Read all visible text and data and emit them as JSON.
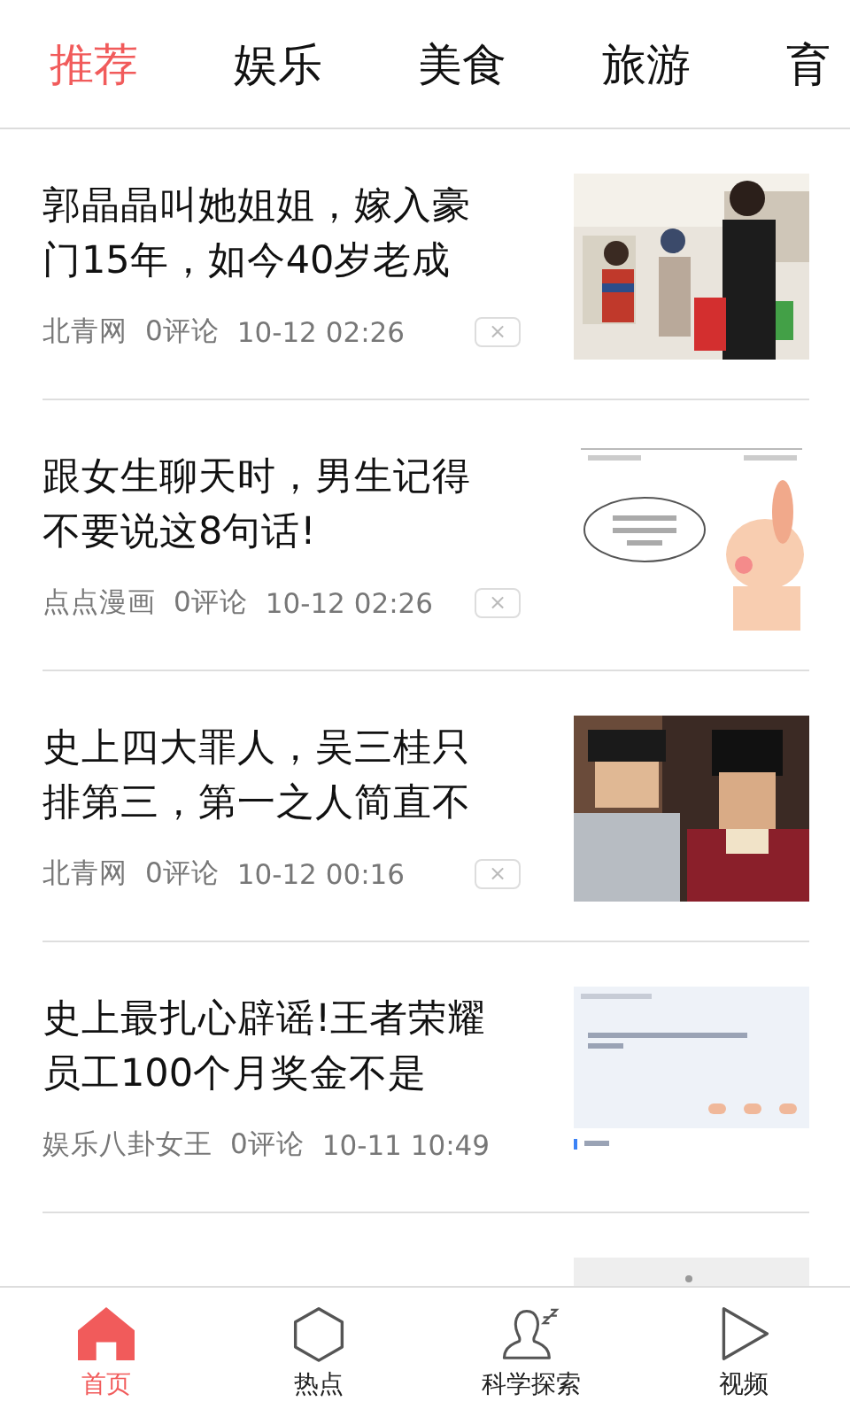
{
  "tabs": [
    {
      "label": "推荐",
      "selected": true
    },
    {
      "label": "娱乐",
      "selected": false
    },
    {
      "label": "美食",
      "selected": false
    },
    {
      "label": "旅游",
      "selected": false
    },
    {
      "label": "育",
      "selected": false
    }
  ],
  "articles": [
    {
      "title": "郭晶晶叫她姐姐，嫁入豪门15年，如今40岁老成",
      "source": "北青网",
      "comments": "0评论",
      "time": "10-12 02:26",
      "dismiss": "×",
      "picture": {
        "kind": "picture"
      }
    },
    {
      "title": "跟女生聊天时，男生记得不要说这8句话!",
      "source": "点点漫画",
      "comments": "0评论",
      "time": "10-12 02:26",
      "dismiss": "×",
      "picture": {
        "kind": "picture"
      }
    },
    {
      "title": "史上四大罪人，吴三桂只排第三，第一之人简直不",
      "source": "北青网",
      "comments": "0评论",
      "time": "10-12 00:16",
      "dismiss": "×",
      "picture": {
        "kind": "picture"
      }
    },
    {
      "title": "史上最扎心辟谣!王者荣耀员工100个月奖金不是",
      "source": "娱乐八卦女王",
      "comments": "0评论",
      "time": "10-11 10:49",
      "picture": {
        "kind": "picture"
      }
    },
    {
      "picture": {
        "kind": "picture"
      }
    }
  ],
  "bottom_nav": [
    {
      "label": "首页",
      "selected": true
    },
    {
      "label": "热点",
      "selected": false
    },
    {
      "label": "科学探索",
      "selected": false
    },
    {
      "label": "视频",
      "selected": false
    }
  ]
}
